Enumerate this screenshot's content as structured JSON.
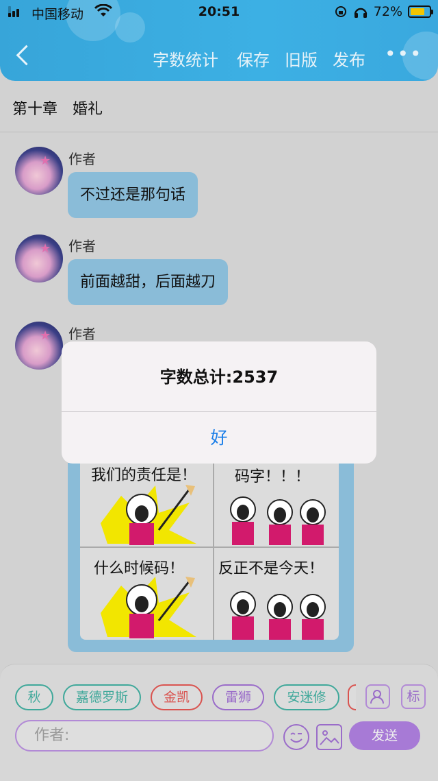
{
  "status_bar": {
    "carrier": "中国移动",
    "time": "20:51",
    "battery": "72%"
  },
  "toolbar": {
    "word_count_label": "字数统计",
    "save_label": "保存",
    "old_version_label": "旧版",
    "publish_label": "发布",
    "more_label": "•••"
  },
  "chapter": {
    "title": "第十章　婚礼"
  },
  "messages": [
    {
      "author": "作者",
      "text": "不过还是那句话"
    },
    {
      "author": "作者",
      "text": "前面越甜，后面越刀"
    },
    {
      "author": "作者"
    }
  ],
  "meme": {
    "top_left": "我们的责任是！",
    "top_right": "码字！！！",
    "bottom_left": "什么时候码！",
    "bottom_right": "反正不是今天！"
  },
  "tags": [
    "秋",
    "嘉德罗斯",
    "金凯",
    "雷狮",
    "安迷修"
  ],
  "tag_colors": [
    "#3fa89a",
    "#3fa89a",
    "#d9534f",
    "#9a6cc9",
    "#3fa89a"
  ],
  "tag_icon_label": "标",
  "composer": {
    "placeholder": "作者:",
    "send_label": "发送"
  },
  "alert": {
    "message": "字数总计:2537",
    "ok_label": "好"
  }
}
